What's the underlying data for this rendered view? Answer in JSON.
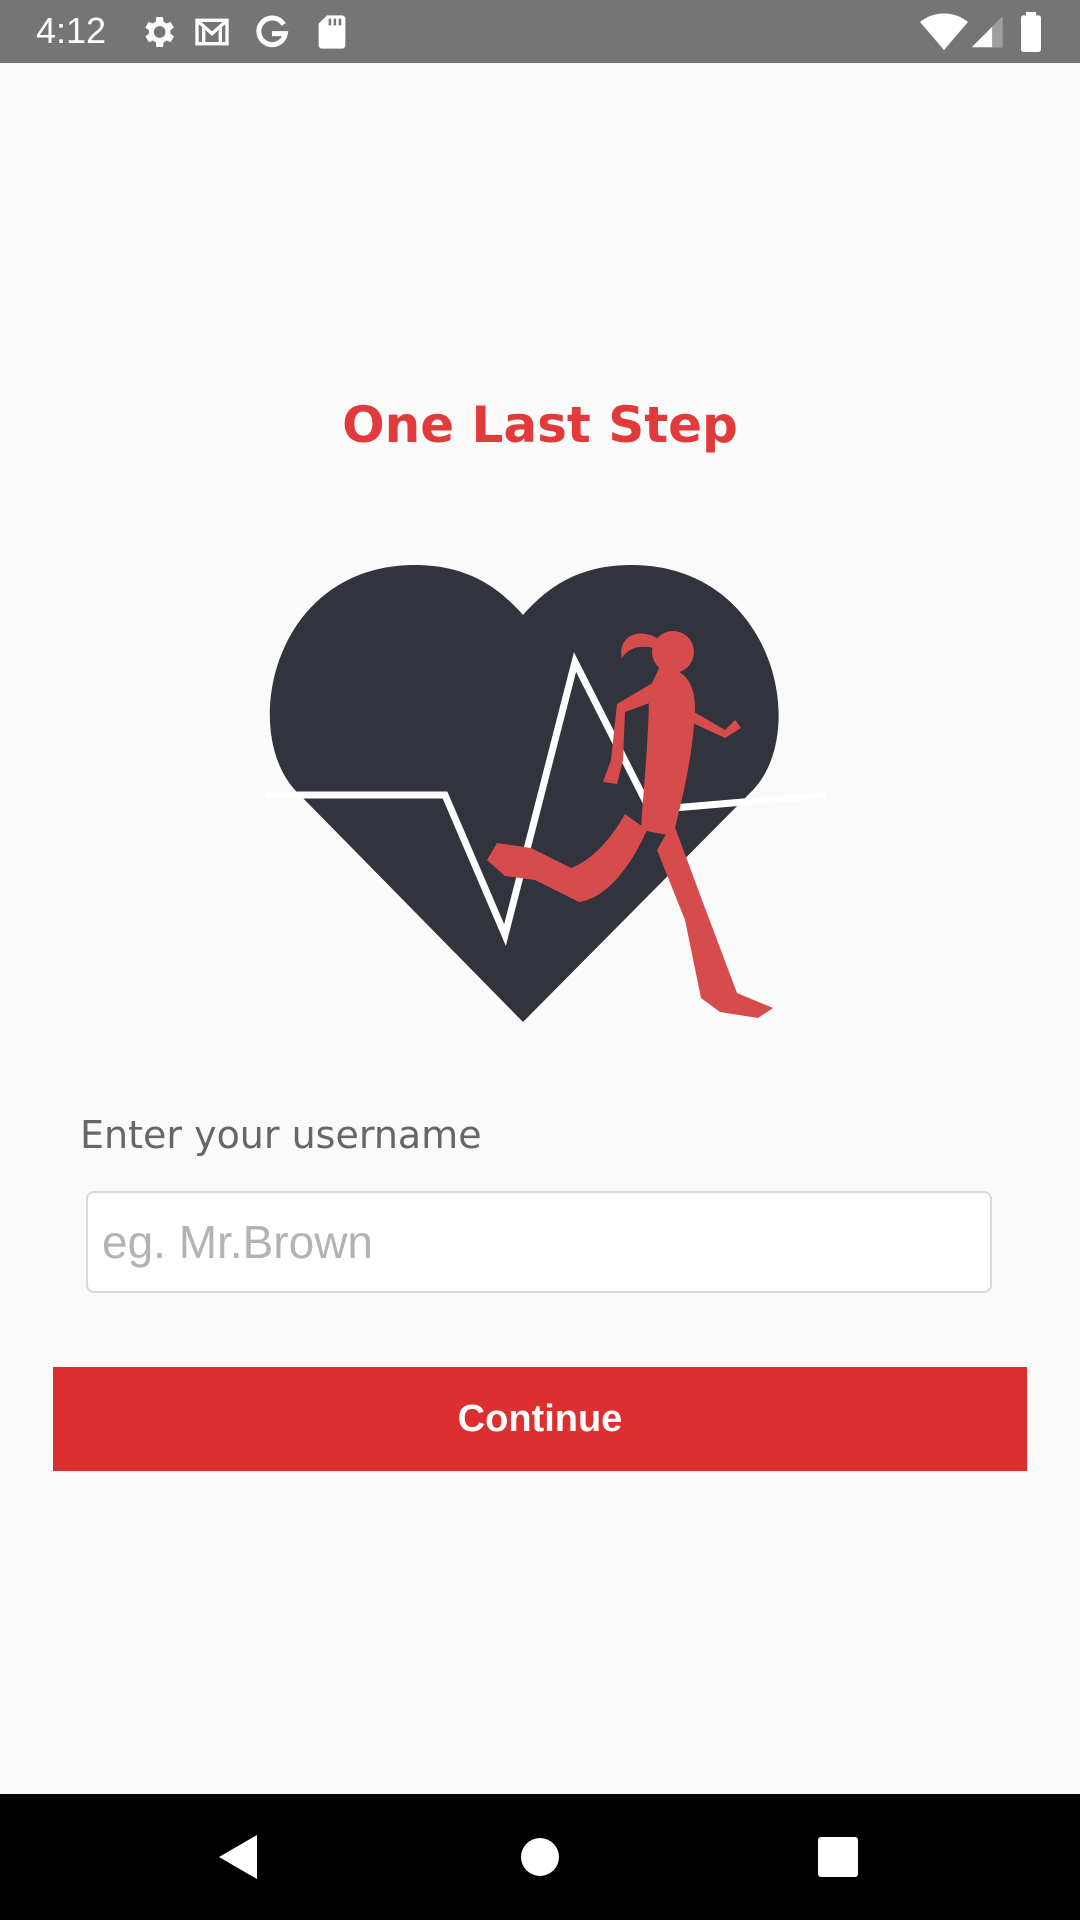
{
  "status_bar": {
    "time": "4:12",
    "left_icons": [
      "gear-icon",
      "gmail-icon",
      "google-icon",
      "sd-card-icon"
    ],
    "right_icons": [
      "wifi-icon",
      "signal-icon",
      "battery-icon"
    ]
  },
  "main": {
    "title": "One Last Step",
    "logo": "heart-runner-logo",
    "username_label": "Enter your username",
    "username_placeholder": "eg. Mr.Brown",
    "username_value": "",
    "continue_label": "Continue"
  },
  "nav_bar": {
    "buttons": [
      "back-icon",
      "home-icon",
      "recents-icon"
    ]
  },
  "colors": {
    "accent": "#dd2f2f",
    "title": "#e03a3a",
    "heart": "#31333d",
    "runner": "#d64c4c",
    "status_bar": "#757575",
    "nav_bar": "#000000"
  }
}
